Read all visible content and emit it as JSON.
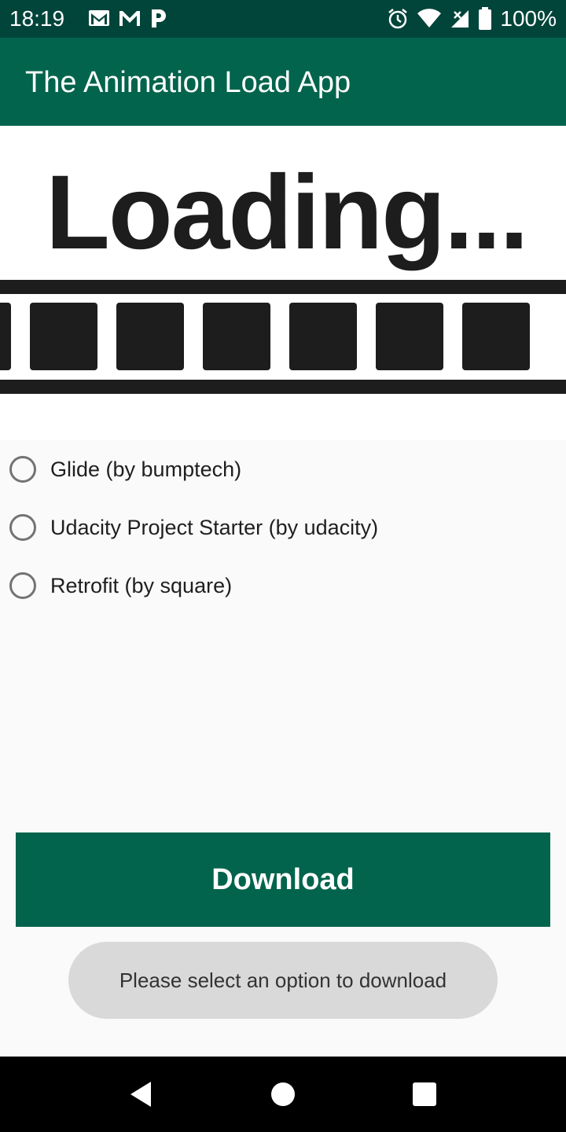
{
  "status_bar": {
    "time": "18:19",
    "battery_text": "100%",
    "left_icons": [
      "gmail-icon",
      "gmail-icon",
      "p-app-icon"
    ],
    "right_icons": [
      "alarm-icon",
      "wifi-icon",
      "cellular-no-data-icon",
      "battery-icon"
    ]
  },
  "app_bar": {
    "title": "The Animation Load App",
    "color": "#02644c"
  },
  "banner": {
    "text": "Loading..."
  },
  "options": [
    {
      "label": "Glide (by bumptech)",
      "selected": false
    },
    {
      "label": "Udacity Project Starter (by udacity)",
      "selected": false
    },
    {
      "label": "Retrofit (by square)",
      "selected": false
    }
  ],
  "download_button": {
    "label": "Download"
  },
  "toast": {
    "message": "Please select an option to download"
  },
  "nav_bar": {
    "buttons": [
      "back-icon",
      "home-icon",
      "recents-icon"
    ]
  }
}
